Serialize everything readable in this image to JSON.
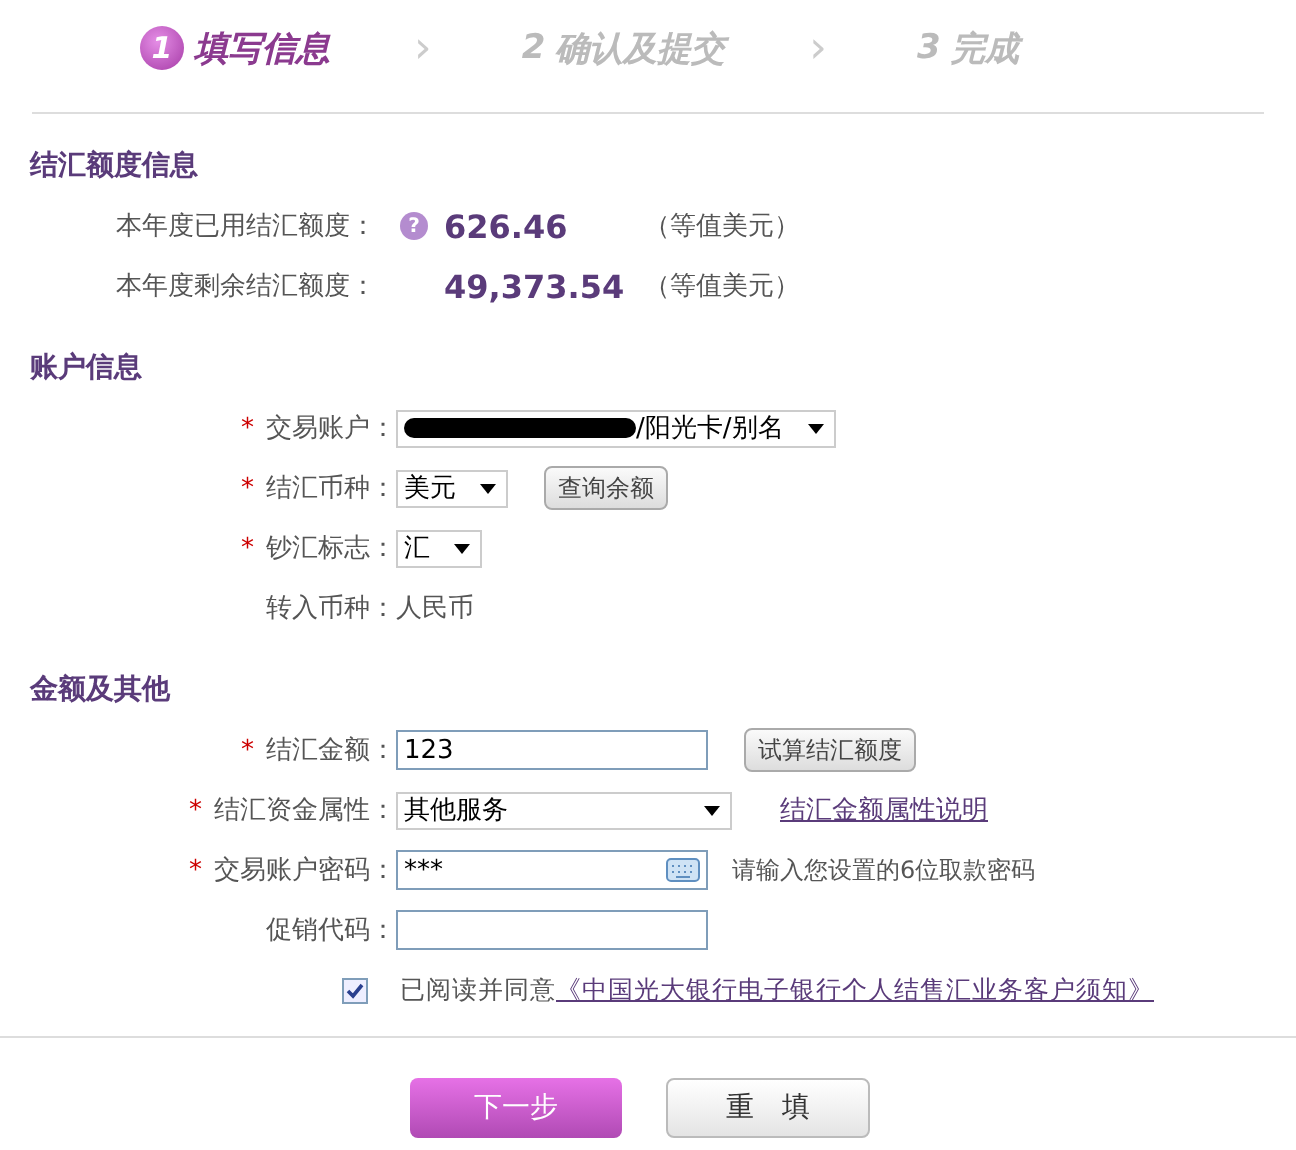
{
  "steps": [
    {
      "number": "1",
      "label": "填写信息",
      "selected": true
    },
    {
      "number": "2",
      "label": "确认及提交",
      "selected": false
    },
    {
      "number": "3",
      "label": "完成",
      "selected": false
    }
  ],
  "step_separators": [
    "›",
    "›"
  ],
  "quota": {
    "title": "结汇额度信息",
    "rows": [
      {
        "label": "本年度已用结汇额度：",
        "help": "?",
        "value": "626.46",
        "unit": "（等值美元）"
      },
      {
        "label": "本年度剩余结汇额度：",
        "value": "49,373.54",
        "unit": "（等值美元）"
      }
    ]
  },
  "account": {
    "title": "账户信息",
    "rows": [
      {
        "kind": "select",
        "required_mark": "*",
        "label": "交易账户：",
        "value": "/阳光卡/别名",
        "redacted": true
      },
      {
        "kind": "select",
        "required_mark": "*",
        "label": "结汇币种：",
        "value": "美元",
        "button": "查询余额"
      },
      {
        "kind": "select",
        "required_mark": "*",
        "label": "钞汇标志：",
        "value": "汇"
      },
      {
        "kind": "text",
        "label": "转入币种：",
        "value": "人民币"
      }
    ]
  },
  "amount": {
    "title": "金额及其他",
    "rows": [
      {
        "kind": "input",
        "required_mark": "*",
        "label": "结汇金额：",
        "value": "123",
        "button": "试算结汇额度"
      },
      {
        "kind": "select",
        "required_mark": "*",
        "label": "结汇资金属性：",
        "value": "其他服务",
        "link": "结汇金额属性说明"
      },
      {
        "kind": "password",
        "required_mark": "*",
        "label": "交易账户密码：",
        "value": "***",
        "hint": "请输入您设置的6位取款密码"
      },
      {
        "kind": "input",
        "label": "促销代码："
      }
    ]
  },
  "agreement": {
    "checked": true,
    "text": "已阅读并同意",
    "link": "《中国光大银行电子银行个人结售汇业务客户须知》"
  },
  "buttons": [
    {
      "kind": "primary",
      "label": "下一步"
    },
    {
      "kind": "secondary",
      "label": "重　填"
    }
  ]
}
